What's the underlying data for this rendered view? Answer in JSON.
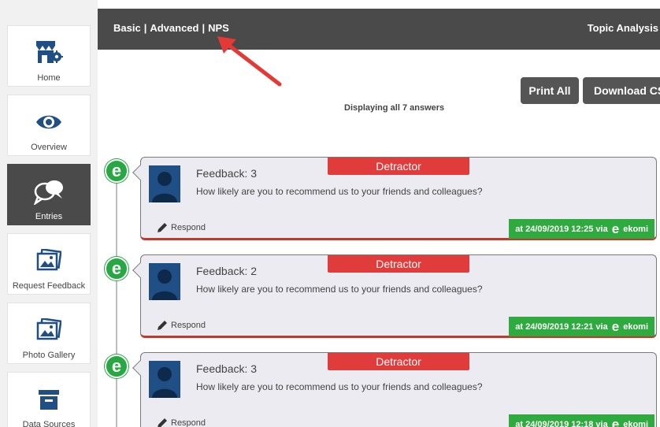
{
  "sidebar": {
    "items": [
      {
        "label": "Home",
        "icon": "store-settings-icon"
      },
      {
        "label": "Overview",
        "icon": "eye-icon"
      },
      {
        "label": "Entries",
        "icon": "chat-bubbles-icon",
        "active": true
      },
      {
        "label": "Request Feedback",
        "icon": "photo-icon"
      },
      {
        "label": "Photo Gallery",
        "icon": "photo-icon"
      },
      {
        "label": "Data Sources",
        "icon": "archive-box-icon"
      }
    ]
  },
  "topbar": {
    "tabs": [
      "Basic",
      "Advanced",
      "NPS"
    ],
    "separator": "|",
    "right_label": "Topic Analysis"
  },
  "buttons": {
    "print_all": "Print All",
    "download_csv": "Download CSV"
  },
  "status": {
    "displaying": "Displaying all 7 answers"
  },
  "entries": [
    {
      "title": "Feedback: 3",
      "question": "How likely are you to recommend us to your friends and colleagues?",
      "badge": "Detractor",
      "respond": "Respond",
      "footer_prefix": "at 24/09/2019 12:25 via",
      "source": "ekomi"
    },
    {
      "title": "Feedback: 2",
      "question": "How likely are you to recommend us to your friends and colleagues?",
      "badge": "Detractor",
      "respond": "Respond",
      "footer_prefix": "at 24/09/2019 12:21 via",
      "source": "ekomi"
    },
    {
      "title": "Feedback: 3",
      "question": "How likely are you to recommend us to your friends and colleagues?",
      "badge": "Detractor",
      "respond": "Respond",
      "footer_prefix": "at 24/09/2019 12:18 via",
      "source": "ekomi"
    }
  ],
  "source_glyph": "e",
  "colors": {
    "topbar": "#4a4a4a",
    "detractor": "#e03c3c",
    "ekomi_green": "#2eaa3f",
    "arrow": "#e53935"
  }
}
